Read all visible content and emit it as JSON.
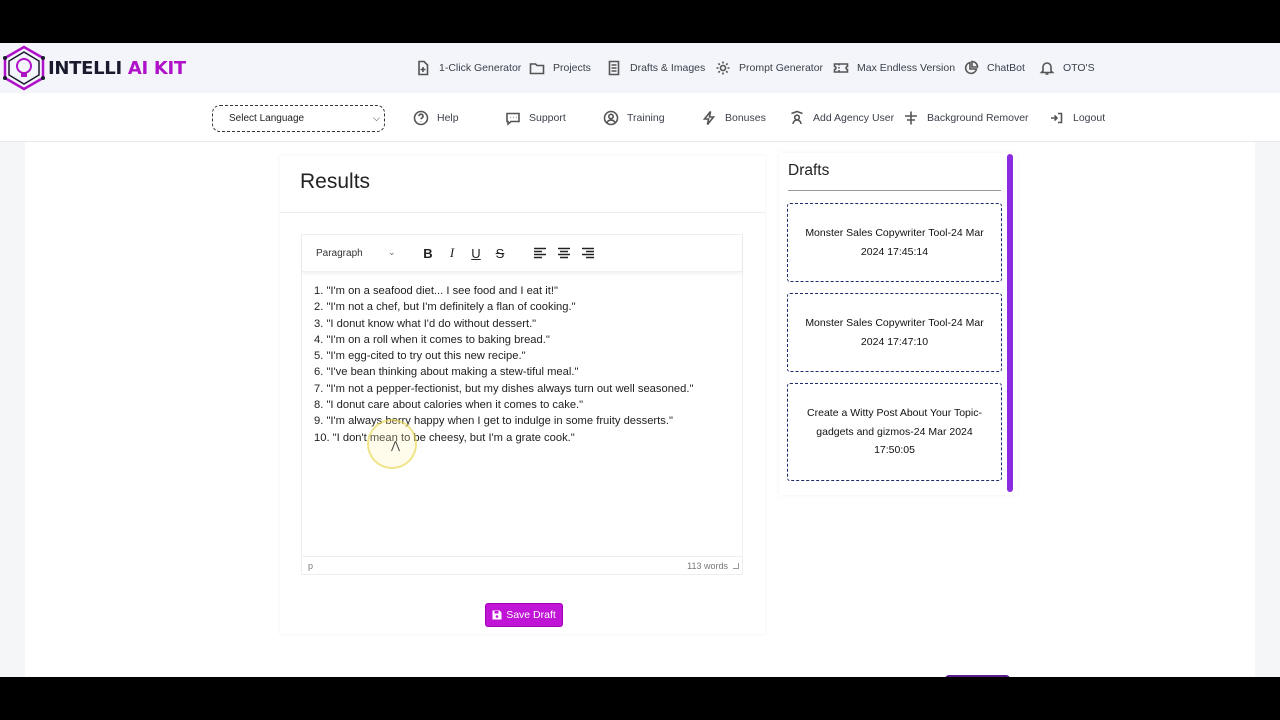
{
  "brand": {
    "part1": "INTELLI ",
    "part2": "AI KIT"
  },
  "topnav": [
    {
      "label": "1-Click Generator",
      "icon": "file-plus-icon"
    },
    {
      "label": "Projects",
      "icon": "folder-icon"
    },
    {
      "label": "Drafts & Images",
      "icon": "document-icon"
    },
    {
      "label": "Prompt Generator",
      "icon": "gear-icon"
    },
    {
      "label": "Max Endless Version",
      "icon": "ticket-icon"
    },
    {
      "label": "ChatBot",
      "icon": "chart-pie-icon"
    },
    {
      "label": "OTO'S",
      "icon": "bell-icon"
    }
  ],
  "language_select": {
    "value": "Select Language"
  },
  "subnav": [
    {
      "label": "Help",
      "icon": "help-circle-icon"
    },
    {
      "label": "Support",
      "icon": "chat-bubble-icon"
    },
    {
      "label": "Training",
      "icon": "user-circle-icon"
    },
    {
      "label": "Bonuses",
      "icon": "bolt-icon"
    },
    {
      "label": "Add Agency User",
      "icon": "user-badge-icon"
    },
    {
      "label": "Background Remover",
      "icon": "sliders-icon"
    },
    {
      "label": "Logout",
      "icon": "logout-icon"
    }
  ],
  "results": {
    "title": "Results",
    "editor": {
      "block_format": "Paragraph",
      "lines": [
        "1. \"I'm on a seafood diet... I see food and I eat it!\"",
        "2. \"I'm not a chef, but I'm definitely a flan of cooking.\"",
        "3. \"I donut know what I'd do without dessert.\"",
        "4. \"I'm on a roll when it comes to baking bread.\"",
        "5. \"I'm egg-cited to try out this new recipe.\"",
        "6. \"I've bean thinking about making a stew-tiful meal.\"",
        "7. \"I'm not a pepper-fectionist, but my dishes always turn out well seasoned.\"",
        "8. \"I donut care about calories when it comes to cake.\"",
        "9. \"I'm always berry happy when I get to indulge in some fruity desserts.\"",
        "10. \"I don't mean to be cheesy, but I'm a grate cook.\""
      ],
      "status_path": "p",
      "word_count": "113 words"
    },
    "save_label": "Save Draft"
  },
  "drafts": {
    "title": "Drafts",
    "items": [
      "Monster Sales Copywriter Tool-24 Mar 2024 17:45:14",
      "Monster Sales Copywriter Tool-24 Mar 2024 17:47:10",
      "Create a Witty Post About Your Topic-gadgets and gizmos-24 Mar 2024 17:50:05"
    ]
  },
  "colors": {
    "accent": "#c014d6",
    "scrollbar": "#8a2be2",
    "brand_dark": "#1a1a2e",
    "brand_purple": "#b012c9"
  }
}
